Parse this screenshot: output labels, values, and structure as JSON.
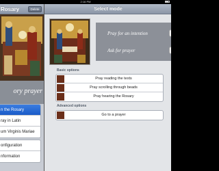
{
  "status": {
    "time": "2:16 PM"
  },
  "master": {
    "title": "Rosary",
    "delete_label": "Delete",
    "caption": "ory prayer",
    "menu_items": [
      {
        "label": "n the Rosary",
        "selected": true
      },
      {
        "label": "ray in Latin",
        "selected": false
      },
      {
        "label": "um Virginis Mariae",
        "selected": false
      }
    ],
    "settings_items": [
      {
        "label": "onfiguration"
      },
      {
        "label": "nformation"
      }
    ]
  },
  "detail": {
    "title": "Select mode",
    "intention_label": "Pray for an intention",
    "ask_label": "Ask for prayer",
    "basic_header": "Basic options",
    "basic_options": [
      {
        "label": "Pray reading the texts"
      },
      {
        "label": "Pray scrolling through beads"
      },
      {
        "label": "Pray hearing the Rosary"
      }
    ],
    "advanced_header": "Advanced options",
    "advanced_options": [
      {
        "label": "Go to a prayer"
      }
    ]
  },
  "colors": {
    "nav_bar": "#98a2b2",
    "selected_row": "#2466d4",
    "panel_gray": "#8c9098",
    "background": "#e3e5e8"
  }
}
